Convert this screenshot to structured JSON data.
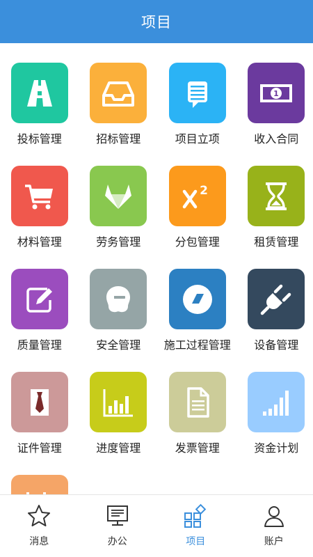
{
  "header": {
    "title": "项目"
  },
  "grid": {
    "items": [
      {
        "label": "投标管理",
        "color": "#1fc7a0",
        "icon": "road-icon"
      },
      {
        "label": "招标管理",
        "color": "#fbb03b",
        "icon": "inbox-icon"
      },
      {
        "label": "项目立项",
        "color": "#2bb3f5",
        "icon": "list-icon"
      },
      {
        "label": "收入合同",
        "color": "#6b3a9e",
        "icon": "banknote-icon"
      },
      {
        "label": "材料管理",
        "color": "#f0584d",
        "icon": "cart-icon"
      },
      {
        "label": "劳务管理",
        "color": "#89c84f",
        "icon": "gitlab-icon"
      },
      {
        "label": "分包管理",
        "color": "#fc9a1c",
        "icon": "superscript-icon"
      },
      {
        "label": "租赁管理",
        "color": "#98b21a",
        "icon": "hourglass-icon"
      },
      {
        "label": "质量管理",
        "color": "#9b4dbe",
        "icon": "edit-icon"
      },
      {
        "label": "安全管理",
        "color": "#95a5a6",
        "icon": "wechat-icon"
      },
      {
        "label": "施工过程管理",
        "color": "#2c80c2",
        "icon": "eraser-icon"
      },
      {
        "label": "设备管理",
        "color": "#34495e",
        "icon": "plug-icon"
      },
      {
        "label": "证件管理",
        "color": "#cc9999",
        "icon": "tie-icon"
      },
      {
        "label": "进度管理",
        "color": "#c7cc1a",
        "icon": "bar-chart-icon"
      },
      {
        "label": "发票管理",
        "color": "#cccc99",
        "icon": "document-icon"
      },
      {
        "label": "资金计划",
        "color": "#99ccff",
        "icon": "signal-icon"
      },
      {
        "label": "",
        "color": "#f5a567",
        "icon": "partial-icon"
      }
    ]
  },
  "tabbar": {
    "items": [
      {
        "label": "消息",
        "icon": "star-icon",
        "active": false
      },
      {
        "label": "办公",
        "icon": "monitor-icon",
        "active": false
      },
      {
        "label": "项目",
        "icon": "apps-icon",
        "active": true
      },
      {
        "label": "账户",
        "icon": "user-icon",
        "active": false
      }
    ]
  },
  "colors": {
    "accent": "#3b8fdc",
    "header_bg": "#3b8fdc",
    "text": "#222222"
  }
}
